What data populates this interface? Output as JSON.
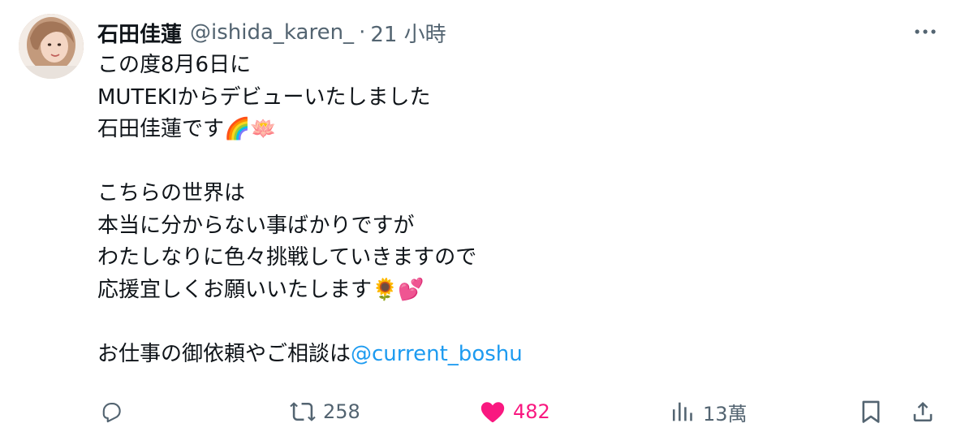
{
  "author": {
    "display_name": "石田佳蓮",
    "handle": "@ishida_karen_",
    "separator": "·",
    "time_ago": "21 小時"
  },
  "tweet_lines": [
    "この度8月6日に",
    "MUTEKIからデビューいたしました",
    "石田佳蓮です",
    "",
    "こちらの世界は",
    "本当に分からない事ばかりですが",
    "わたしなりに色々挑戦していきますので",
    "応援宜しくお願いいたします",
    "",
    "お仕事の御依頼やご相談は"
  ],
  "emojis": {
    "line3": [
      "🌈",
      "🪷"
    ],
    "line8": [
      "🌻",
      "💕"
    ]
  },
  "mention": "@current_boshu",
  "actions": {
    "reply_count": "",
    "retweet_count": "258",
    "like_count": "482",
    "views_count": "13萬"
  },
  "colors": {
    "text": "#0f1419",
    "secondary": "#536471",
    "link": "#1d9bf0",
    "like": "#f91880"
  },
  "icons": {
    "more": "more-horizontal-icon",
    "reply": "reply-icon",
    "retweet": "retweet-icon",
    "like": "heart-filled-icon",
    "views": "views-bar-chart-icon",
    "bookmark": "bookmark-icon",
    "share": "share-icon"
  }
}
